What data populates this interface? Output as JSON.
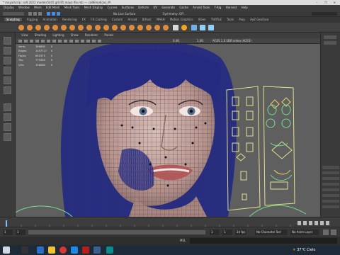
{
  "window": {
    "title": "* maya/scrip: ca9.2022 models5405 gIll.95 maya file.mb   ---   ca9Emotions_M",
    "controls": "–  ❐  ✕"
  },
  "menubar": {
    "items": [
      "Display",
      "Window",
      "Mesh",
      "Edit Mesh",
      "Mesh Tools",
      "Mesh Display",
      "Curves",
      "Surfaces",
      "Deform",
      "UV",
      "Generate",
      "Cache",
      "Arnold Tools",
      "T-Rig",
      "Harvest",
      "Help"
    ]
  },
  "shelf": {
    "tabs": [
      "Sculpting",
      "Rigging",
      "Animation",
      "Rendering",
      "FX",
      "FX Caching",
      "Custom",
      "Arnold",
      "Bifrost",
      "MASH",
      "Motion Graphics",
      "XGen",
      "TURTLE",
      "Tools",
      "Pulp",
      "AeZ GeoFace"
    ],
    "active_tab": "Sculpting",
    "no_live_surface": "No Live Surface",
    "symmetry": "Symmetry: Off"
  },
  "panel": {
    "menu": [
      "View",
      "Shading",
      "Lighting",
      "Show",
      "Renderer",
      "Panels"
    ],
    "readout_a": "0.00",
    "readout_b": "1.00",
    "color_space": "ACES 1.0 SDR-video (ACES)"
  },
  "stats": [
    {
      "label": "Verts:",
      "value": "366608",
      "extra": "0"
    },
    {
      "label": "Edges:",
      "value": "1057717",
      "extra": "0"
    },
    {
      "label": "Faces:",
      "value": "692373",
      "extra": "0"
    },
    {
      "label": "Tris:",
      "value": "779456",
      "extra": "0"
    },
    {
      "label": "UVs:",
      "value": "758008",
      "extra": "0"
    }
  ],
  "range": {
    "start": "1",
    "end": "1",
    "fps": "24 fps",
    "character_set": "No Character Set",
    "anim_layer": "No Anim Layer"
  },
  "cmdline": {
    "label": "MEL"
  },
  "taskbar": {
    "temperature": "37°C",
    "weather": "Cielo"
  }
}
